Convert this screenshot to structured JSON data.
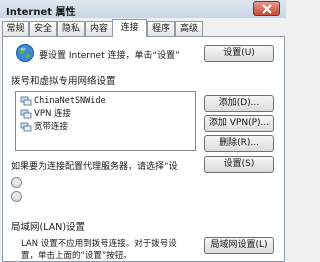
{
  "window": {
    "title": "Internet 属性"
  },
  "tabs": [
    {
      "label": "常规"
    },
    {
      "label": "安全"
    },
    {
      "label": "隐私"
    },
    {
      "label": "内容"
    },
    {
      "label": "连接"
    },
    {
      "label": "程序"
    },
    {
      "label": "高级"
    }
  ],
  "active_tab": "连接",
  "setup": {
    "text": "要设置 Internet 连接，单击“设置”",
    "button": "设置(U)"
  },
  "dialup": {
    "heading": "拨号和虚拟专用网络设置",
    "connections": [
      {
        "label": "ChinaNetSNWide"
      },
      {
        "label": "VPN 连接"
      },
      {
        "label": "宽带连接"
      }
    ],
    "add_button": "添加(D)...",
    "add_vpn_button": "添加 VPN(P)...",
    "delete_button": "删除(R)...",
    "proxy_text": "如果要为连接配置代理服务器，请选择“设",
    "settings_button": "设置(S)"
  },
  "lan": {
    "heading": "局域网(LAN)设置",
    "text_line1": "LAN 设置不应用到拨号连接。对于拨号设",
    "text_line2": "置，单击上面的“设置”按钮。",
    "button": "局域网设置(L)"
  },
  "colors": {
    "titlebar": "#c9d6e6",
    "close_button": "#c74a3a",
    "panel": "#ffffff",
    "border": "#8e9aa8"
  },
  "icons": [
    "close-icon",
    "globe-icon",
    "network-connection-icon"
  ]
}
